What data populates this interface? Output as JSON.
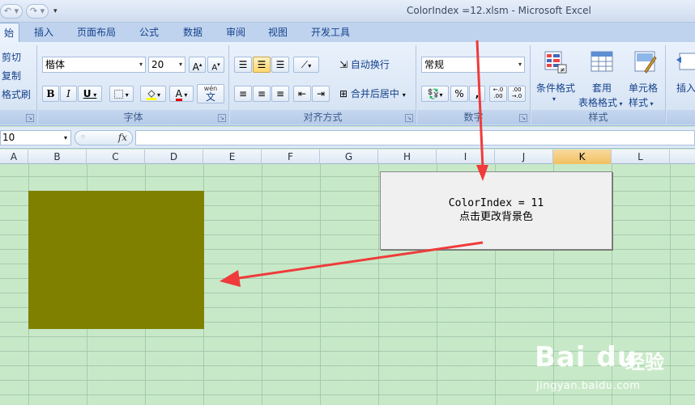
{
  "window": {
    "title": "ColorIndex =12.xlsm - Microsoft Excel"
  },
  "tabs": [
    "始",
    "插入",
    "页面布局",
    "公式",
    "数据",
    "审阅",
    "视图",
    "开发工具"
  ],
  "ribbon": {
    "clipboard": {
      "cut": "剪切",
      "copy": "复制",
      "format_painter": "格式刷"
    },
    "font": {
      "label": "字体",
      "name": "楷体",
      "size": "20",
      "bold": "B",
      "italic": "I",
      "underline": "U",
      "font_color_glyph": "A",
      "wen": "wén",
      "wen_char": "文"
    },
    "alignment": {
      "label": "对齐方式",
      "wrap": "自动换行",
      "merge": "合并后居中"
    },
    "number": {
      "label": "数字",
      "format": "常规",
      "percent": "%",
      "comma": ",",
      "inc": "←.0 .00",
      "dec": ".00 →.0"
    },
    "styles": {
      "label": "样式",
      "conditional": "条件格式",
      "table_line1": "套用",
      "table_line2": "表格格式",
      "cell_line1": "单元格",
      "cell_line2": "样式"
    },
    "cells": {
      "insert": "插入"
    }
  },
  "formula_bar": {
    "name_box": "10",
    "fx": "fx"
  },
  "columns": [
    {
      "name": "A",
      "selected": false
    },
    {
      "name": "B",
      "selected": false
    },
    {
      "name": "C",
      "selected": false
    },
    {
      "name": "D",
      "selected": false
    },
    {
      "name": "E",
      "selected": false
    },
    {
      "name": "F",
      "selected": false
    },
    {
      "name": "G",
      "selected": false
    },
    {
      "name": "H",
      "selected": false
    },
    {
      "name": "I",
      "selected": false
    },
    {
      "name": "J",
      "selected": false
    },
    {
      "name": "K",
      "selected": true
    },
    {
      "name": "L",
      "selected": false
    }
  ],
  "sheet": {
    "shape_color": "#808000",
    "sheet_bg": "#c8e9c8",
    "arrow_color": "#ef3b3b",
    "button": {
      "line1": "ColorIndex = 11",
      "line2": "点击更改背景色"
    }
  },
  "watermark": {
    "logo": "Bai du",
    "cn": "经验",
    "url": "jingyan.baidu.com"
  }
}
